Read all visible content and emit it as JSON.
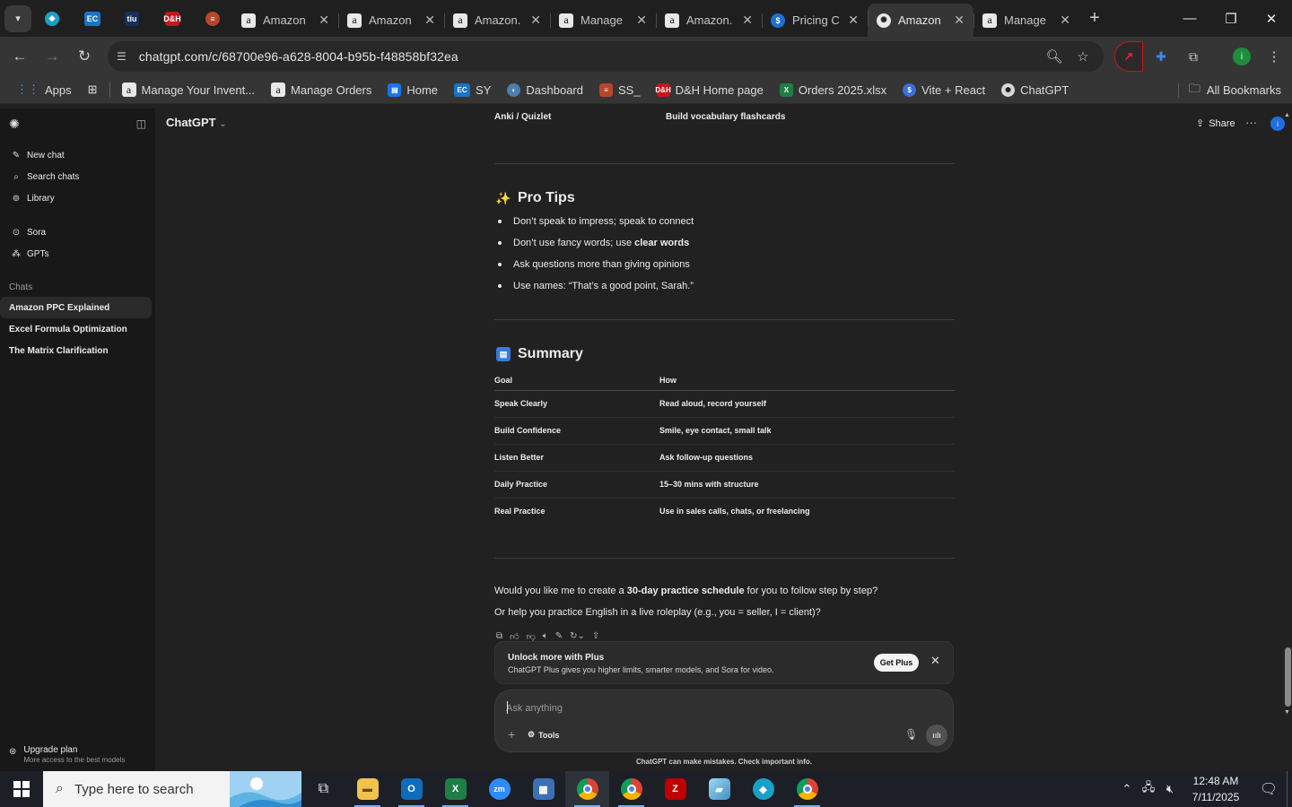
{
  "browser": {
    "tabs": [
      {
        "title": "Amazon",
        "active": false
      },
      {
        "title": "Amazon",
        "active": false
      },
      {
        "title": "Amazon.",
        "active": false
      },
      {
        "title": "Manage",
        "active": false
      },
      {
        "title": "Amazon.",
        "active": false
      },
      {
        "title": "Pricing C",
        "active": false
      },
      {
        "title": "Amazon",
        "active": true
      },
      {
        "title": "Manage",
        "active": false
      }
    ],
    "url": "chatgpt.com/c/68700e96-a628-8004-b95b-f48858bf32ea",
    "bookmarks": [
      "Apps",
      "Manage Your Invent...",
      "Manage Orders",
      "Home",
      "SY",
      "Dashboard",
      "SS_",
      "D&H Home page",
      "Orders 2025.xlsx",
      "Vite + React",
      "ChatGPT"
    ],
    "all_bookmarks": "All Bookmarks",
    "profile_initial": "i"
  },
  "sidebar": {
    "items": [
      {
        "label": "New chat",
        "icon": "edit-icon"
      },
      {
        "label": "Search chats",
        "icon": "search-icon"
      },
      {
        "label": "Library",
        "icon": "library-icon"
      },
      {
        "label": "Sora",
        "icon": "play-icon"
      },
      {
        "label": "GPTs",
        "icon": "grid-icon"
      }
    ],
    "section": "Chats",
    "chats": [
      "Amazon PPC Explained",
      "Excel Formula Optimization",
      "The Matrix Clarification"
    ],
    "upgrade_title": "Upgrade plan",
    "upgrade_sub": "More access to the best models"
  },
  "header": {
    "model": "ChatGPT",
    "share": "Share",
    "avatar": "i"
  },
  "content": {
    "top_row": {
      "tool": "Anki / Quizlet",
      "use": "Build vocabulary flashcards"
    },
    "pro_tips": {
      "title": "Pro Tips",
      "tips": [
        "Don’t speak to impress; speak to connect",
        "Don’t use fancy words; use ",
        "Ask questions more than giving opinions",
        "Use names: “That’s a good point, Sarah.”"
      ],
      "tip2_bold": "clear words"
    },
    "summary": {
      "title": "Summary",
      "headers": [
        "Goal",
        "How"
      ],
      "rows": [
        [
          "Speak Clearly",
          "Read aloud, record yourself"
        ],
        [
          "Build Confidence",
          "Smile, eye contact, small talk"
        ],
        [
          "Listen Better",
          "Ask follow-up questions"
        ],
        [
          "Daily Practice",
          "15–30 mins with structure"
        ],
        [
          "Real Practice",
          "Use in sales calls, chats, or freelancing"
        ]
      ]
    },
    "followup_1_pre": "Would you like me to create a ",
    "followup_1_bold": "30-day practice schedule",
    "followup_1_post": " for you to follow step by step?",
    "followup_2": "Or help you practice English in a live roleplay (e.g., you = seller, I = client)?"
  },
  "banner": {
    "title": "Unlock more with Plus",
    "subtitle": "ChatGPT Plus gives you higher limits, smarter models, and Sora for video.",
    "button": "Get Plus"
  },
  "composer": {
    "placeholder": "Ask anything",
    "tools": "Tools"
  },
  "disclaimer": "ChatGPT can make mistakes. Check important info.",
  "taskbar": {
    "search_placeholder": "Type here to search",
    "time": "12:48 AM",
    "date": "7/11/2025"
  }
}
